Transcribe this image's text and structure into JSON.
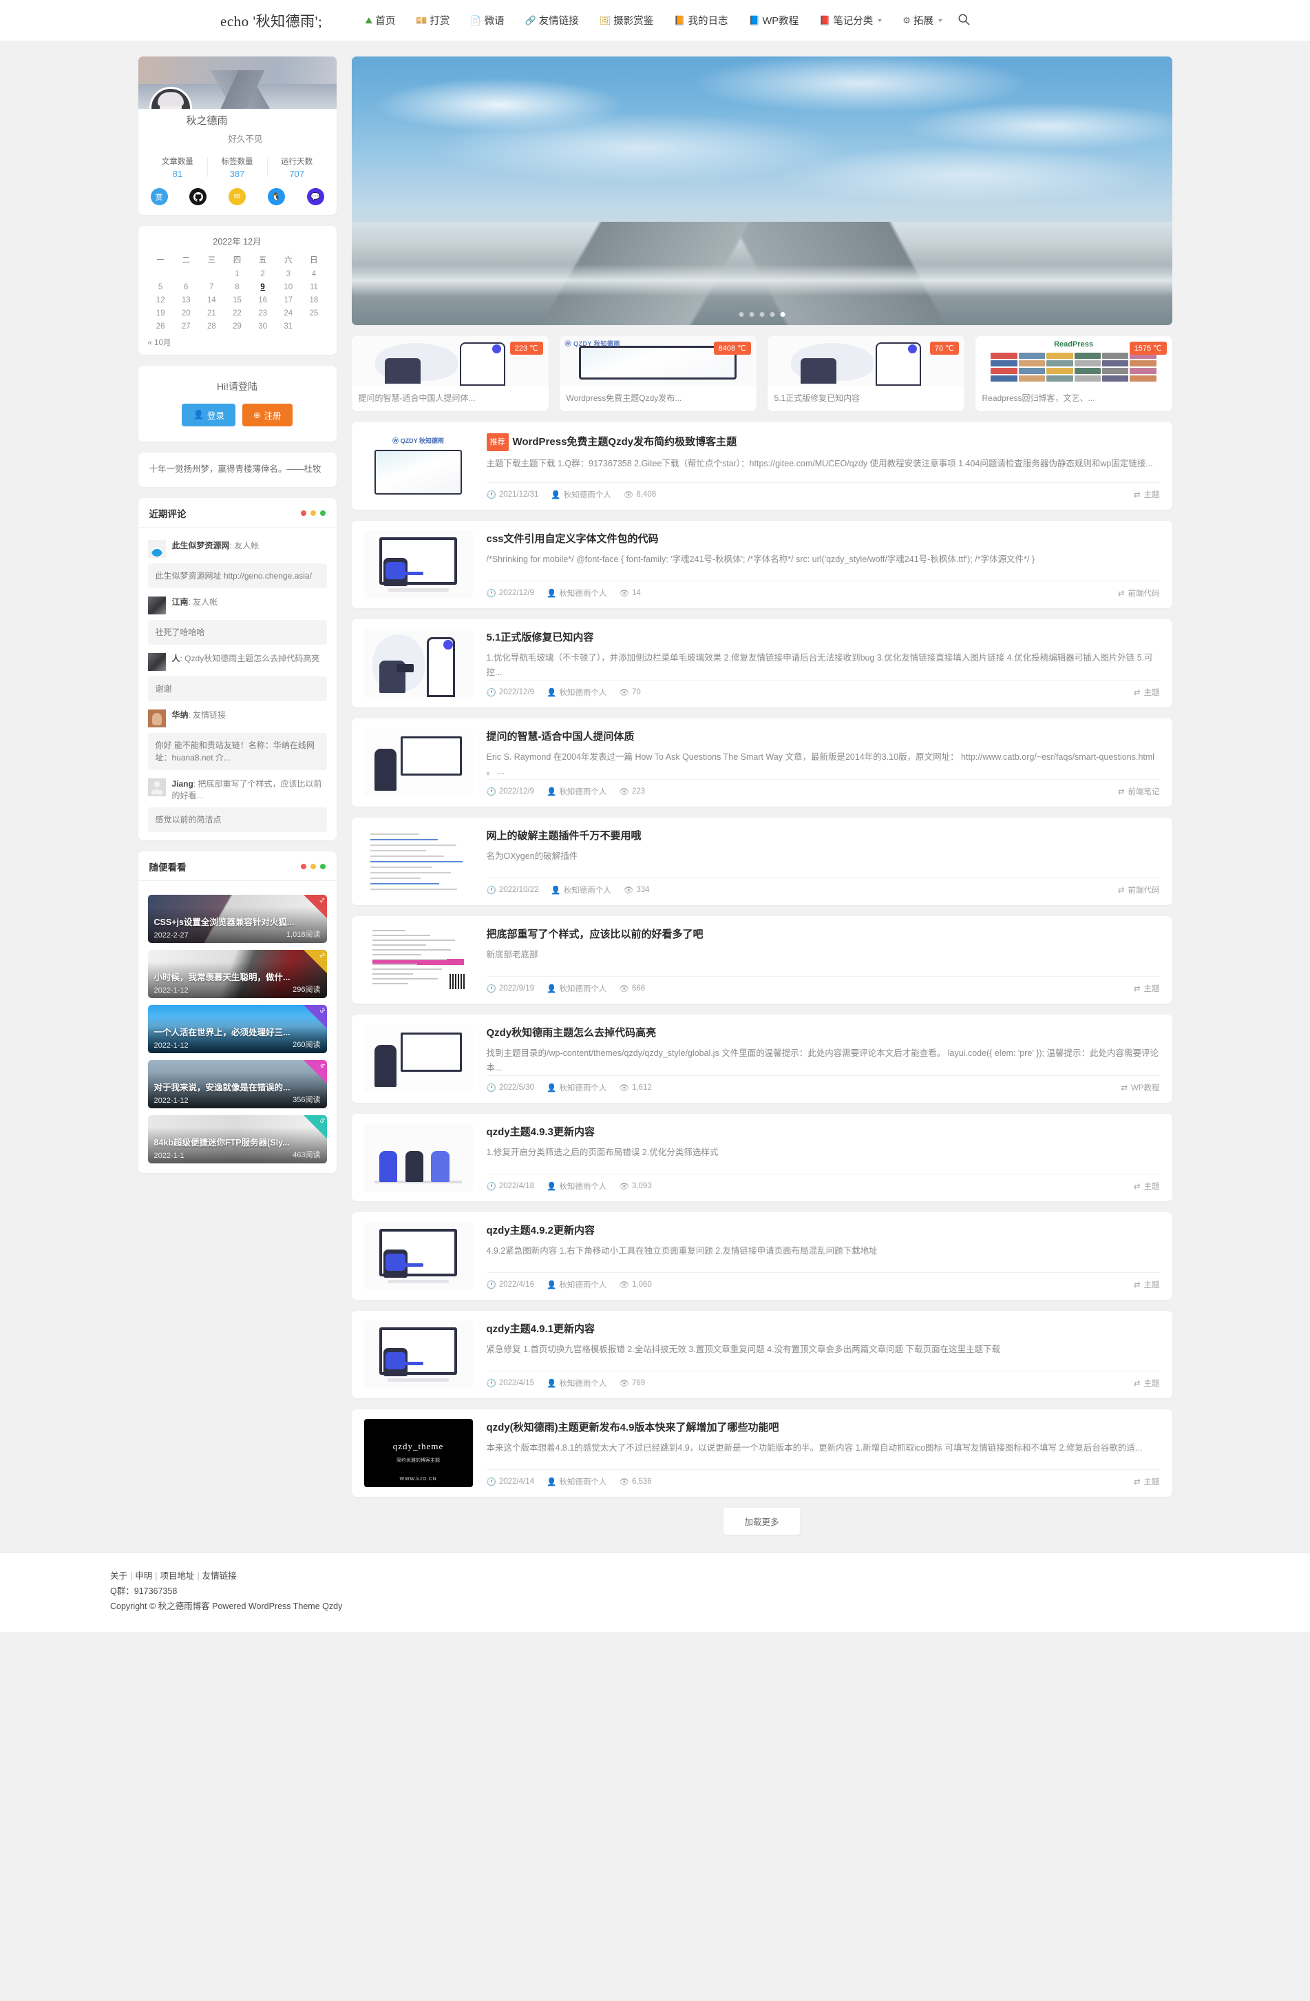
{
  "header": {
    "brand": "echo '秋知德雨';",
    "nav": [
      {
        "label": "首页",
        "icon": "mountain-icon",
        "glyph": "⛰",
        "color": "#4a9c3e",
        "caret": false
      },
      {
        "label": "打赏",
        "icon": "money-icon",
        "glyph": "💴",
        "color": "#7fa36a",
        "caret": false
      },
      {
        "label": "微语",
        "icon": "note-icon",
        "glyph": "📄",
        "color": "#8fa8c8",
        "caret": false
      },
      {
        "label": "友情链接",
        "icon": "link-icon",
        "glyph": "🔗",
        "color": "#3a3a3a",
        "caret": false
      },
      {
        "label": "摄影赏鉴",
        "icon": "photo-icon",
        "glyph": "🖼",
        "color": "#c9a227",
        "caret": false
      },
      {
        "label": "我的日志",
        "icon": "diary-icon",
        "glyph": "📙",
        "color": "#e0943a",
        "caret": false
      },
      {
        "label": "WP教程",
        "icon": "book-icon",
        "glyph": "📘",
        "color": "#2f7fd0",
        "caret": false
      },
      {
        "label": "笔记分类",
        "icon": "notebook-icon",
        "glyph": "📕",
        "color": "#d0342c",
        "caret": true
      },
      {
        "label": "拓展",
        "icon": "gear-icon",
        "glyph": "⚙",
        "color": "#6a6a6a",
        "caret": true
      }
    ],
    "search_label": "搜索"
  },
  "profile": {
    "name": "秋之德雨",
    "description": "好久不见",
    "stats": [
      {
        "label": "文章数量",
        "value": "81"
      },
      {
        "label": "标签数量",
        "value": "387"
      },
      {
        "label": "运行天数",
        "value": "707"
      }
    ],
    "socials": [
      {
        "name": "reward-icon",
        "glyph": "赏",
        "color": "#3ba3e8"
      },
      {
        "name": "github-icon",
        "glyph": "",
        "color": "#151515"
      },
      {
        "name": "email-icon",
        "glyph": "✉",
        "color": "#f5c022"
      },
      {
        "name": "qq-icon",
        "glyph": "🐧",
        "color": "#2196f3"
      },
      {
        "name": "wechat-icon",
        "glyph": "💬",
        "color": "#4b2ee0"
      }
    ]
  },
  "calendar": {
    "caption": "2022年 12月",
    "weekdays": [
      "一",
      "二",
      "三",
      "四",
      "五",
      "六",
      "日"
    ],
    "weeks": [
      [
        "",
        "",
        "",
        "1",
        "2",
        "3",
        "4"
      ],
      [
        "5",
        "6",
        "7",
        "8",
        "9",
        "10",
        "11"
      ],
      [
        "12",
        "13",
        "14",
        "15",
        "16",
        "17",
        "18"
      ],
      [
        "19",
        "20",
        "21",
        "22",
        "23",
        "24",
        "25"
      ],
      [
        "26",
        "27",
        "28",
        "29",
        "30",
        "31",
        ""
      ]
    ],
    "today": "9",
    "prev_label": "« 10月"
  },
  "login": {
    "title": "Hi!请登陆",
    "login_label": "登录",
    "register_label": "注册"
  },
  "quote": {
    "text": "十年一觉扬州梦，赢得青楼薄倖名。——杜牧"
  },
  "comments_widget": {
    "title": "近期评论",
    "items": [
      {
        "avatar": "av-doraemon",
        "author": "此生似梦资源网",
        "post": "友人帐",
        "body": "此生似梦资源网址 http://geno.chenge.asia/"
      },
      {
        "avatar": "av-dark",
        "author": "江南",
        "post": "友人帐",
        "body": "社死了哈哈哈"
      },
      {
        "avatar": "av-dark",
        "author": "人",
        "post": "Qzdy秋知德雨主题怎么去掉代码高亮",
        "body": "谢谢"
      },
      {
        "avatar": "av-man",
        "author": "华纳",
        "post": "友情链接",
        "body": "你好 能不能和贵站友链！名称：华纳在线网址：huana8.net 介..."
      },
      {
        "avatar": "av-anon",
        "author": "Jiang",
        "post": "把底部重写了个样式，应该比以前的好看...",
        "body": "感觉以前的简洁点"
      }
    ]
  },
  "randoms_widget": {
    "title": "随便看看",
    "items": [
      {
        "rank": "1",
        "title": "CSS+js设置全浏览器兼容针对火狐...",
        "date": "2022-2-27",
        "views": "1,018阅读",
        "corner": "#e04a4a",
        "bg": "linear-gradient(120deg,#3a4a66 0%,#6f5a6a 40%,#d6d6d6 41%,#f4f4f4 100%)"
      },
      {
        "rank": "2",
        "title": "小时候，我常羡慕天生聪明，做什...",
        "date": "2022-1-12",
        "views": "296阅读",
        "corner": "#e6b422",
        "bg": "linear-gradient(110deg,#f2f2f2 0%,#dedede 45%,#5a5a5a 55%,#8b2226 75%,#3a3a3a 100%)"
      },
      {
        "rank": "3",
        "title": "一个人活在世界上，必须处理好三...",
        "date": "2022-1-12",
        "views": "260阅读",
        "corner": "#7b4de0",
        "bg": "linear-gradient(to bottom,#2fa6ef 0%,#6fc3f5 45%,#1a5f8e 100%)"
      },
      {
        "rank": "4",
        "title": "对于我来说，安逸就像是在错误的...",
        "date": "2022-1-12",
        "views": "356阅读",
        "corner": "#e04ac0",
        "bg": "linear-gradient(to bottom,#9fb4c4 0%,#7e95a8 55%,#3e4a55 100%)"
      },
      {
        "rank": "5",
        "title": "84kb超级便捷迷你FTP服务器(Sly...",
        "date": "2022-1-1",
        "views": "463阅读",
        "corner": "#2ec4b6",
        "bg": "linear-gradient(to right,#e8e8e8 0%,#dcdcdc 48%,#f2f2f2 100%)"
      }
    ]
  },
  "hero": {
    "slides_count": 5,
    "active_slide": 5
  },
  "hot_cards": [
    {
      "badge": "223 ℃",
      "title": "提问的智慧-适合中国人提问体...",
      "thumb": "photographer"
    },
    {
      "badge": "8408 ℃",
      "title": "Wordpress免费主题Qzdy发布...",
      "thumb": "wordpress"
    },
    {
      "badge": "70 ℃",
      "title": "5.1正式版修复已知内容",
      "thumb": "photographer"
    },
    {
      "badge": "1575 ℃",
      "title": "Readpress回归博客，文艺、...",
      "thumb": "readpress"
    }
  ],
  "posts": [
    {
      "tag": "推荐",
      "title": "WordPress免费主题Qzdy发布简约极致博客主题",
      "excerpt": "主题下载主题下载 1.Q群：917367358 2.Gitee下载（帮忙点个star）：https://gitee.com/MUCEO/qzdy 使用教程安装注意事项 1.404问题请检查服务器伪静态规则和wp固定链接...",
      "date": "2021/12/31",
      "author": "秋知德雨个人",
      "views": "8,408",
      "category": "主题",
      "thumb": "wp-banner"
    },
    {
      "tag": "",
      "title": "css文件引用自定义字体文件包的代码",
      "excerpt": "/*Shrinking for mobile*/ @font-face { font-family: '字魂241号-秋枫体'; /*字体名称*/ src: url('qzdy_style/woff/字魂241号-秋枫体.ttf'); /*字体源文件*/ }",
      "date": "2022/12/9",
      "author": "秋知德雨个人",
      "views": "14",
      "category": "前端代码",
      "thumb": "monitor"
    },
    {
      "tag": "",
      "title": "5.1正式版修复已知内容",
      "excerpt": "1.优化导航毛玻璃（不卡顿了），并添加侧边栏菜单毛玻璃效果 2.修复友情链接申请后台无法接收到bug 3.优化友情链接直接填入图片链接 4.优化投稿编辑器可插入图片外链 5.可控...",
      "date": "2022/12/9",
      "author": "秋知德雨个人",
      "views": "70",
      "category": "主题",
      "thumb": "photographer"
    },
    {
      "tag": "",
      "title": "提问的智慧-适合中国人提问体质",
      "excerpt": "Eric S. Raymond 在2004年发表过一篇 How To Ask Questions The Smart Way 文章，最新版是2014年的3.10版，原文网址： http://www.catb.org/~esr/faqs/smart-questions.html 。 ...",
      "date": "2022/12/9",
      "author": "秋知德雨个人",
      "views": "223",
      "category": "前端笔记",
      "thumb": "easel"
    },
    {
      "tag": "",
      "title": "网上的破解主题插件千万不要用哦",
      "excerpt": "名为OXygen的破解插件",
      "date": "2022/10/22",
      "author": "秋知德雨个人",
      "views": "334",
      "category": "前端代码",
      "thumb": "webpage"
    },
    {
      "tag": "",
      "title": "把底部重写了个样式，应该比以前的好看多了吧",
      "excerpt": "新底部老底部",
      "date": "2022/9/19",
      "author": "秋知德雨个人",
      "views": "666",
      "category": "主题",
      "thumb": "doc"
    },
    {
      "tag": "",
      "title": "Qzdy秋知德雨主题怎么去掉代码高亮",
      "excerpt": "找到主题目录的/wp-content/themes/qzdy/qzdy_style/global.js 文件里面的温馨提示：此处内容需要评论本文后才能查看。 layui.code({ elem: 'pre' }); 温馨提示：此处内容需要评论本...",
      "date": "2022/5/30",
      "author": "秋知德雨个人",
      "views": "1,612",
      "category": "WP教程",
      "thumb": "easel"
    },
    {
      "tag": "",
      "title": "qzdy主题4.9.3更新内容",
      "excerpt": "1.修复开启分类筛选之后的页面布局错误 2.优化分类筛选样式",
      "date": "2022/4/18",
      "author": "秋知德雨个人",
      "views": "3,093",
      "category": "主题",
      "thumb": "team"
    },
    {
      "tag": "",
      "title": "qzdy主题4.9.2更新内容",
      "excerpt": "4.9.2紧急图新内容 1.右下角移动小工具在独立页面重复问题 2.友情链接申请页面布局混乱问题下载地址",
      "date": "2022/4/16",
      "author": "秋知德雨个人",
      "views": "1,060",
      "category": "主题",
      "thumb": "monitor"
    },
    {
      "tag": "",
      "title": "qzdy主题4.9.1更新内容",
      "excerpt": "紧急修复 1.首页切换九宫格模板报错 2.全站抖披无效 3.置顶文章重复问题 4.没有置顶文章会多出两篇文章问题 下载页面在这里主题下载",
      "date": "2022/4/15",
      "author": "秋知德雨个人",
      "views": "769",
      "category": "主题",
      "thumb": "monitor"
    },
    {
      "tag": "",
      "title": "qzdy(秋知德雨)主题更新发布4.9版本快来了解增加了哪些功能吧",
      "excerpt": "本来这个版本想着4.8.1的感觉太大了不过已经跳到4.9，以说更新是一个功能版本的半。更新内容 1.新增自动抓取ico图标 可填写友情链接图标和不填写 2.修复后台谷歌的适...",
      "date": "2022/4/14",
      "author": "秋知德雨个人",
      "views": "6,536",
      "category": "主题",
      "thumb": "qzdy-dark"
    }
  ],
  "loadmore": {
    "label": "加载更多"
  },
  "footer": {
    "links": [
      "关于",
      "申明",
      "项目地址",
      "友情链接"
    ],
    "qq_line": "Q群：917367358",
    "copyright": "Copyright © 秋之德雨博客 Powered WordPress Theme Qzdy"
  }
}
